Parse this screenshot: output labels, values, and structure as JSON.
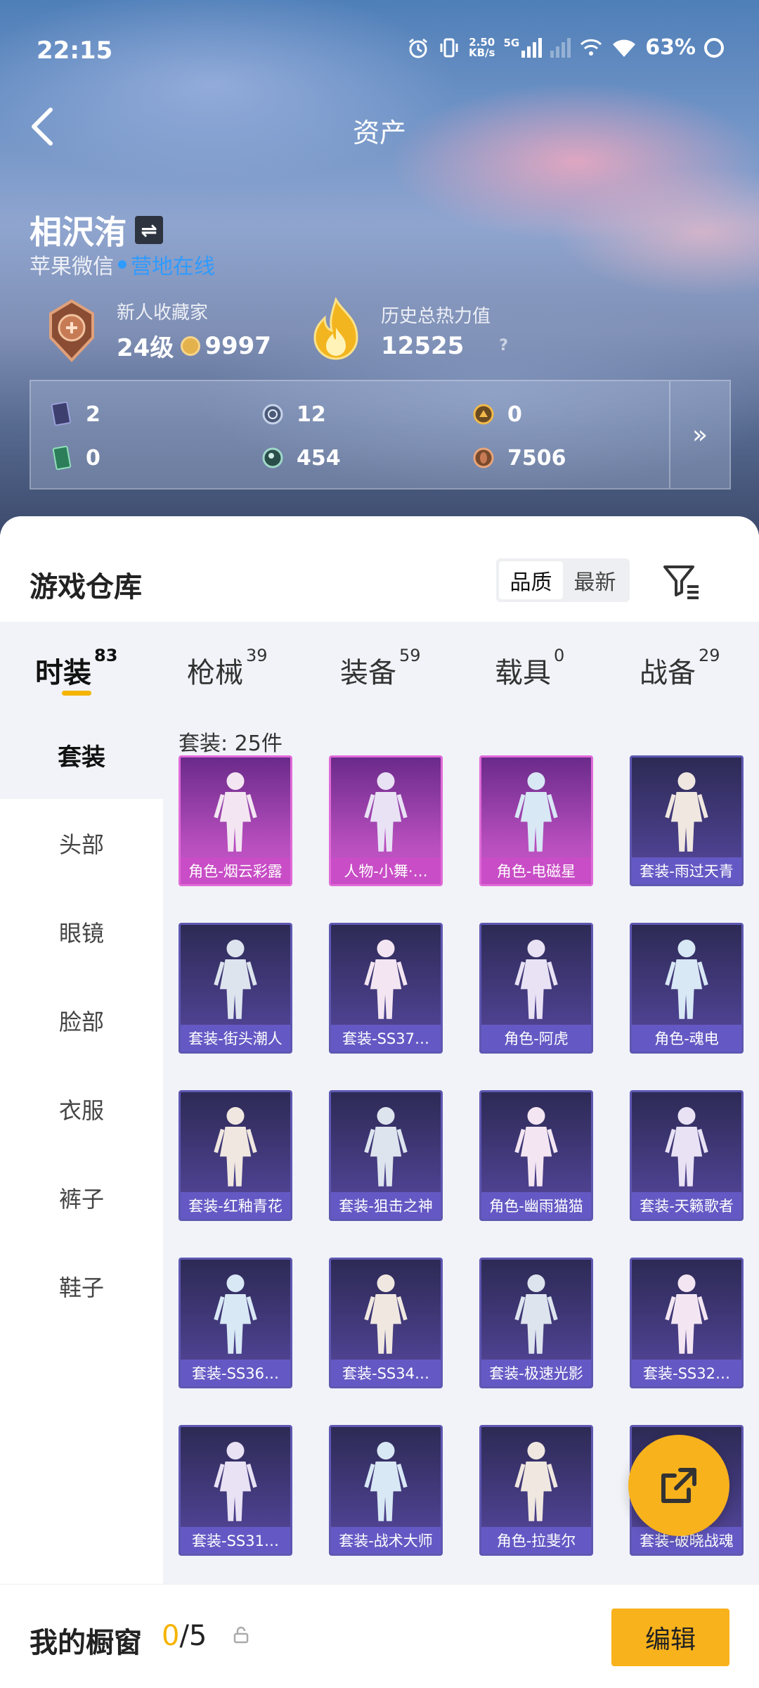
{
  "status_bar": {
    "time": "22:15",
    "net_speed_top": "2.50",
    "net_speed_bottom": "KB/s",
    "network": "5G",
    "battery": "63%"
  },
  "header": {
    "title": "资产",
    "user_name": "相沢洧",
    "platform": "苹果微信",
    "online_status": "营地在线"
  },
  "stats": {
    "collector": {
      "label": "新人收藏家",
      "level": "24级",
      "coins": "9997"
    },
    "heat": {
      "label": "历史总热力值",
      "value": "12525",
      "help": "?"
    }
  },
  "resources": {
    "items": [
      {
        "icon": "card-icon",
        "value": "2"
      },
      {
        "icon": "silver-coin-icon",
        "value": "12"
      },
      {
        "icon": "gold-token-icon",
        "value": "0"
      },
      {
        "icon": "green-ticket-icon",
        "value": "0"
      },
      {
        "icon": "gem-icon",
        "value": "454"
      },
      {
        "icon": "bronze-coin-icon",
        "value": "7506"
      }
    ],
    "more": "»"
  },
  "warehouse": {
    "title": "游戏仓库",
    "sort": {
      "quality": "品质",
      "newest": "最新"
    },
    "tabs": [
      {
        "label": "时装",
        "count": "83"
      },
      {
        "label": "枪械",
        "count": "39"
      },
      {
        "label": "装备",
        "count": "59"
      },
      {
        "label": "载具",
        "count": "0"
      },
      {
        "label": "战备",
        "count": "29"
      }
    ],
    "categories": [
      "套装",
      "头部",
      "眼镜",
      "脸部",
      "衣服",
      "裤子",
      "鞋子"
    ],
    "count_label": "套装: 25件",
    "items": [
      {
        "label": "角色-烟云彩露",
        "rarity": "pink"
      },
      {
        "label": "人物-小舞·…",
        "rarity": "pink"
      },
      {
        "label": "角色-电磁星",
        "rarity": "pink"
      },
      {
        "label": "套装-雨过天青",
        "rarity": "blue"
      },
      {
        "label": "套装-街头潮人",
        "rarity": "blue"
      },
      {
        "label": "套装-SS37…",
        "rarity": "blue"
      },
      {
        "label": "角色-阿虎",
        "rarity": "blue"
      },
      {
        "label": "角色-魂电",
        "rarity": "blue"
      },
      {
        "label": "套装-红釉青花",
        "rarity": "blue"
      },
      {
        "label": "套装-狙击之神",
        "rarity": "blue"
      },
      {
        "label": "角色-幽雨猫猫",
        "rarity": "blue"
      },
      {
        "label": "套装-天籁歌者",
        "rarity": "blue"
      },
      {
        "label": "套装-SS36…",
        "rarity": "blue"
      },
      {
        "label": "套装-SS34…",
        "rarity": "blue"
      },
      {
        "label": "套装-极速光影",
        "rarity": "blue"
      },
      {
        "label": "套装-SS32…",
        "rarity": "blue"
      },
      {
        "label": "套装-SS31…",
        "rarity": "blue"
      },
      {
        "label": "套装-战术大师",
        "rarity": "blue"
      },
      {
        "label": "角色-拉斐尔",
        "rarity": "blue"
      },
      {
        "label": "套装-破晓战魂",
        "rarity": "blue"
      }
    ]
  },
  "showcase": {
    "title": "我的橱窗",
    "current": "0",
    "total": "/5",
    "edit": "编辑"
  },
  "colors": {
    "accent": "#f8b21c",
    "online": "#2f9bff",
    "rarity_pink": "#c84dc6",
    "rarity_blue": "#6459c4"
  }
}
